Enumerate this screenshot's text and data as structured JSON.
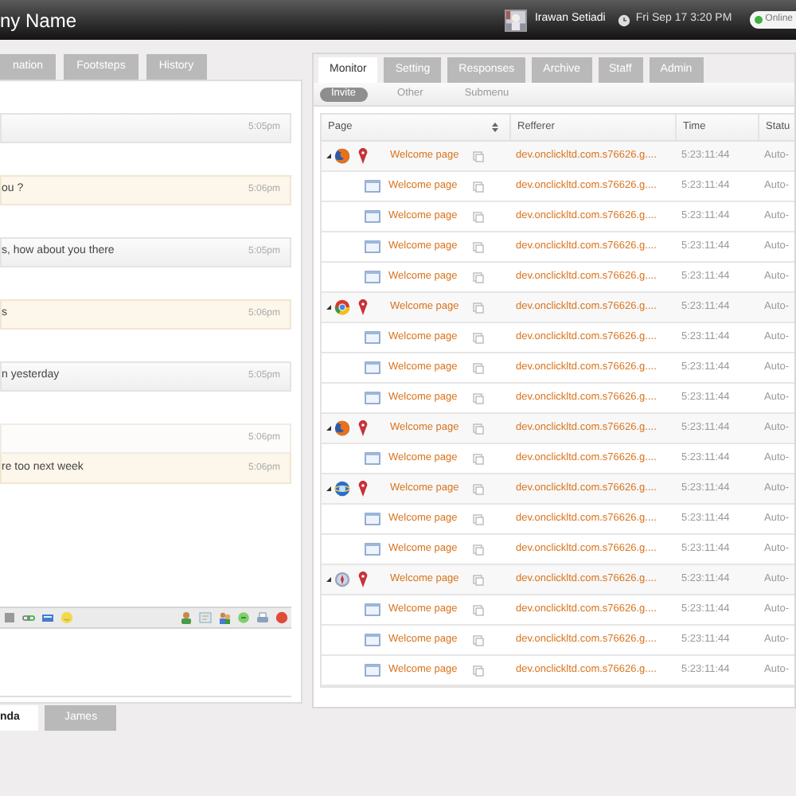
{
  "header": {
    "title": "ny Name",
    "user": "Irawan Setiadi",
    "datetime": "Fri Sep 17 3:20 PM",
    "status": "Online"
  },
  "left_tabs": [
    {
      "label": "nation",
      "selected": false
    },
    {
      "label": "Footsteps",
      "selected": false
    },
    {
      "label": "History",
      "selected": false
    }
  ],
  "messages": [
    {
      "kind": "them",
      "time": "5:05pm",
      "joined": false
    },
    {
      "kind": "me",
      "text": "ou ?",
      "time": "5:06pm",
      "joined": false
    },
    {
      "kind": "them",
      "text": "s, how about you there",
      "time": "5:05pm",
      "joined": false
    },
    {
      "kind": "me",
      "text": "s",
      "time": "5:06pm",
      "joined": false
    },
    {
      "kind": "them",
      "text": "n yesterday",
      "time": "5:05pm",
      "joined": false
    },
    {
      "kind": "plain",
      "time": "5:06pm",
      "joined": false
    },
    {
      "kind": "me",
      "text": "re too next week",
      "time": "5:06pm",
      "joined": true
    }
  ],
  "chat_tabs": [
    {
      "label": "nda",
      "selected": true
    },
    {
      "label": "James",
      "selected": false
    }
  ],
  "right_tabs": [
    {
      "label": "Monitor",
      "selected": true
    },
    {
      "label": "Setting",
      "selected": false
    },
    {
      "label": "Responses",
      "selected": false
    },
    {
      "label": "Archive",
      "selected": false
    },
    {
      "label": "Staff",
      "selected": false
    },
    {
      "label": "Admin",
      "selected": false
    }
  ],
  "subtabs": [
    {
      "label": "Invite",
      "selected": true
    },
    {
      "label": "Other",
      "selected": false
    },
    {
      "label": "Submenu",
      "selected": false
    }
  ],
  "table": {
    "columns": [
      "Page",
      "Refferer",
      "Time",
      "Statu"
    ],
    "rows": [
      {
        "kind": "firefox",
        "expanded": true,
        "page": "Welcome page",
        "referrer": "dev.onclickltd.com.s76626.g....",
        "time": "5:23:11:44",
        "status": "Auto-",
        "children": [
          {
            "page": "Welcome page",
            "referrer": "dev.onclickltd.com.s76626.g....",
            "time": "5:23:11:44",
            "status": "Auto-"
          },
          {
            "page": "Welcome page",
            "referrer": "dev.onclickltd.com.s76626.g....",
            "time": "5:23:11:44",
            "status": "Auto-"
          },
          {
            "page": "Welcome page",
            "referrer": "dev.onclickltd.com.s76626.g....",
            "time": "5:23:11:44",
            "status": "Auto-"
          },
          {
            "page": "Welcome page",
            "referrer": "dev.onclickltd.com.s76626.g....",
            "time": "5:23:11:44",
            "status": "Auto-"
          }
        ]
      },
      {
        "kind": "chrome",
        "expanded": true,
        "page": "Welcome page",
        "referrer": "dev.onclickltd.com.s76626.g....",
        "time": "5:23:11:44",
        "status": "Auto-",
        "children": [
          {
            "page": "Welcome page",
            "referrer": "dev.onclickltd.com.s76626.g....",
            "time": "5:23:11:44",
            "status": "Auto-"
          },
          {
            "page": "Welcome page",
            "referrer": "dev.onclickltd.com.s76626.g....",
            "time": "5:23:11:44",
            "status": "Auto-"
          },
          {
            "page": "Welcome page",
            "referrer": "dev.onclickltd.com.s76626.g....",
            "time": "5:23:11:44",
            "status": "Auto-"
          }
        ]
      },
      {
        "kind": "firefox",
        "expanded": true,
        "page": "Welcome page",
        "referrer": "dev.onclickltd.com.s76626.g....",
        "time": "5:23:11:44",
        "status": "Auto-",
        "children": [
          {
            "page": "Welcome page",
            "referrer": "dev.onclickltd.com.s76626.g....",
            "time": "5:23:11:44",
            "status": "Auto-"
          }
        ]
      },
      {
        "kind": "ie",
        "expanded": true,
        "page": "Welcome page",
        "referrer": "dev.onclickltd.com.s76626.g....",
        "time": "5:23:11:44",
        "status": "Auto-",
        "children": [
          {
            "page": "Welcome page",
            "referrer": "dev.onclickltd.com.s76626.g....",
            "time": "5:23:11:44",
            "status": "Auto-"
          },
          {
            "page": "Welcome page",
            "referrer": "dev.onclickltd.com.s76626.g....",
            "time": "5:23:11:44",
            "status": "Auto-"
          }
        ]
      },
      {
        "kind": "safari",
        "expanded": true,
        "page": "Welcome page",
        "referrer": "dev.onclickltd.com.s76626.g....",
        "time": "5:23:11:44",
        "status": "Auto-",
        "children": [
          {
            "page": "Welcome page",
            "referrer": "dev.onclickltd.com.s76626.g....",
            "time": "5:23:11:44",
            "status": "Auto-"
          },
          {
            "page": "Welcome page",
            "referrer": "dev.onclickltd.com.s76626.g....",
            "time": "5:23:11:44",
            "status": "Auto-"
          },
          {
            "page": "Welcome page",
            "referrer": "dev.onclickltd.com.s76626.g....",
            "time": "5:23:11:44",
            "status": "Auto-"
          }
        ]
      }
    ]
  }
}
